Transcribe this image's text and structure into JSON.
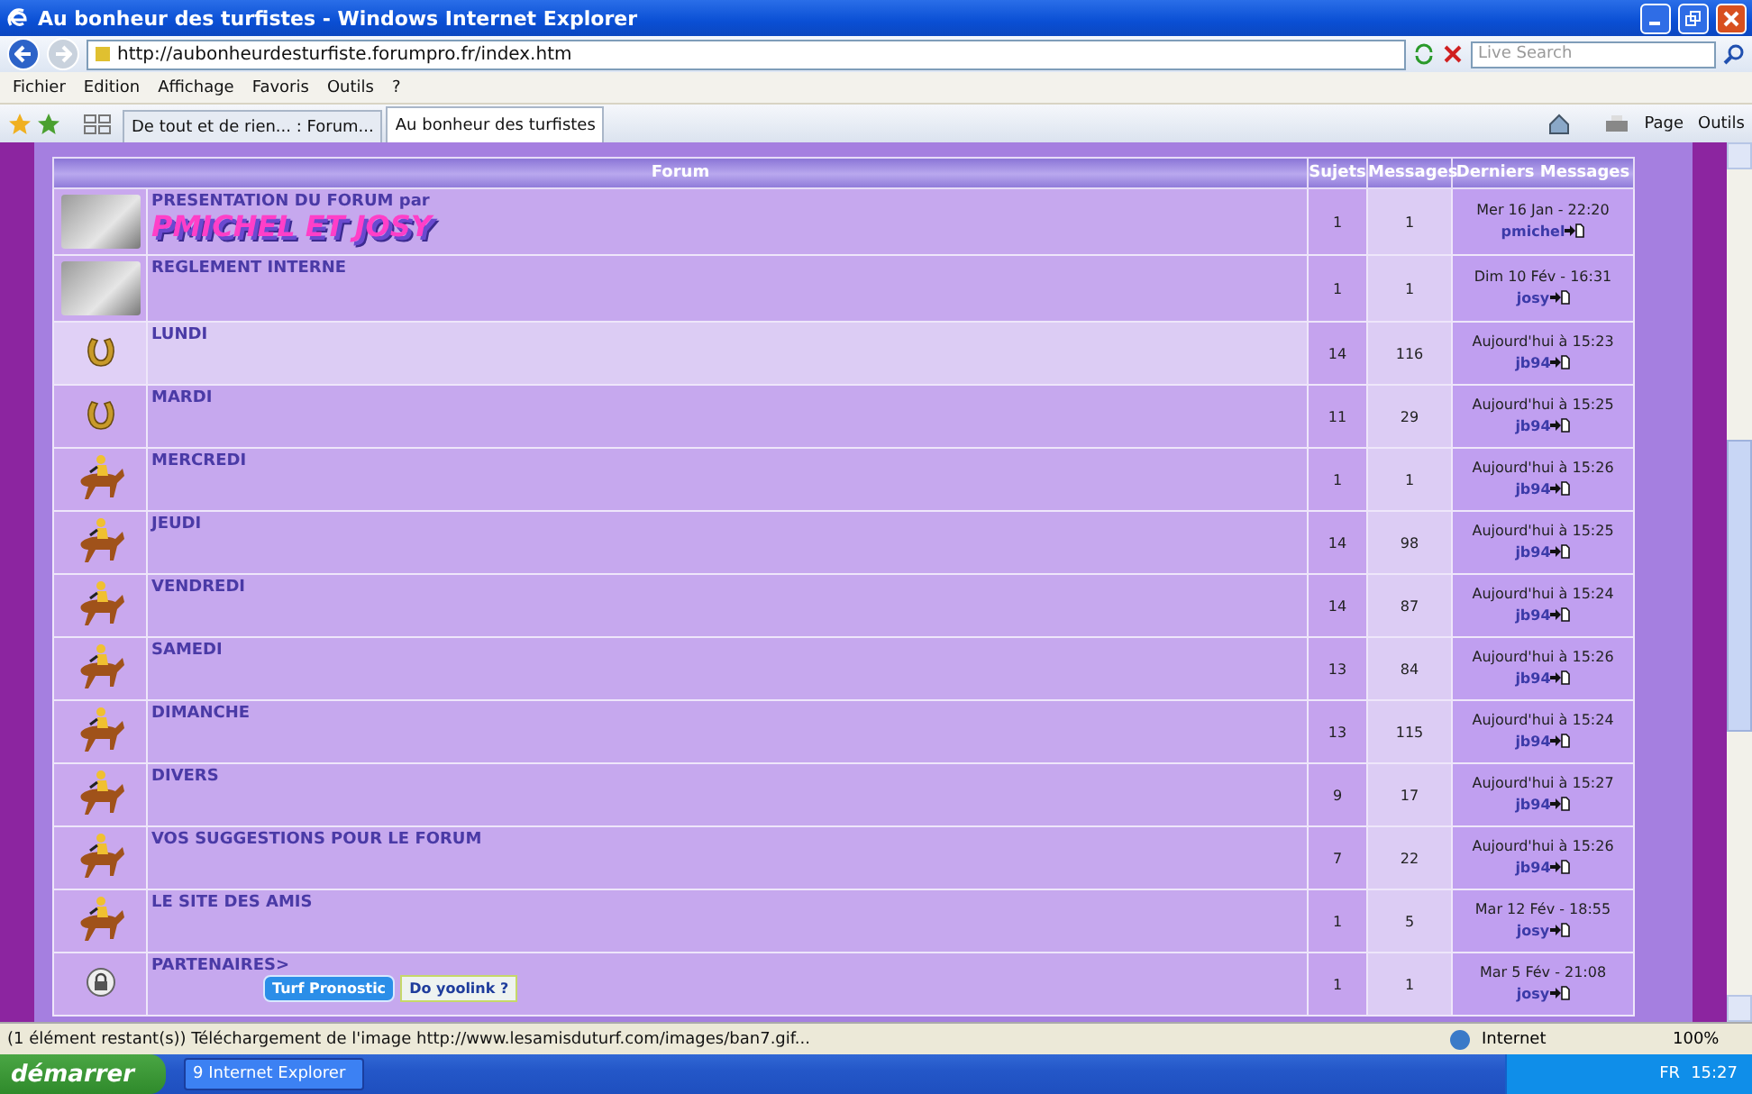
{
  "window": {
    "title": "Au bonheur des turfistes - Windows Internet Explorer"
  },
  "address": {
    "url": "http://aubonheurdesturfiste.forumpro.fr/index.htm"
  },
  "search": {
    "placeholder": "Live Search"
  },
  "menu": [
    "Fichier",
    "Edition",
    "Affichage",
    "Favoris",
    "Outils",
    "?"
  ],
  "tabs": [
    {
      "label": "De tout et de rien... : Forum...",
      "selected": false
    },
    {
      "label": "Au bonheur des turfistes",
      "selected": true
    }
  ],
  "toolbar": [
    "Page",
    "Outils"
  ],
  "table": {
    "columns": [
      "Forum",
      "Sujets",
      "Messages",
      "Derniers Messages"
    ],
    "rows": [
      {
        "kind": "photo",
        "title": "PRESENTATION DU FORUM par",
        "banner": "PMICHEL ET JOSY",
        "highlighted": false,
        "topics": "1",
        "posts": "1",
        "last_date": "Mer 16 Jan - 22:20",
        "last_user": "pmichel"
      },
      {
        "kind": "photo",
        "title": "REGLEMENT INTERNE",
        "highlighted": false,
        "topics": "1",
        "posts": "1",
        "last_date": "Dim 10 Fév - 16:31",
        "last_user": "josy"
      },
      {
        "kind": "horseshoe",
        "title": "LUNDI",
        "highlighted": true,
        "topics": "14",
        "posts": "116",
        "last_date": "Aujourd'hui à 15:23",
        "last_user": "jb94"
      },
      {
        "kind": "horseshoe",
        "title": "MARDI",
        "highlighted": false,
        "topics": "11",
        "posts": "29",
        "last_date": "Aujourd'hui à 15:25",
        "last_user": "jb94"
      },
      {
        "kind": "jockey",
        "title": "MERCREDI",
        "highlighted": false,
        "topics": "1",
        "posts": "1",
        "last_date": "Aujourd'hui à 15:26",
        "last_user": "jb94"
      },
      {
        "kind": "jockey",
        "title": "JEUDI",
        "highlighted": false,
        "topics": "14",
        "posts": "98",
        "last_date": "Aujourd'hui à 15:25",
        "last_user": "jb94"
      },
      {
        "kind": "jockey",
        "title": "VENDREDI",
        "highlighted": false,
        "topics": "14",
        "posts": "87",
        "last_date": "Aujourd'hui à 15:24",
        "last_user": "jb94"
      },
      {
        "kind": "jockey",
        "title": "SAMEDI",
        "highlighted": false,
        "topics": "13",
        "posts": "84",
        "last_date": "Aujourd'hui à 15:26",
        "last_user": "jb94"
      },
      {
        "kind": "jockey",
        "title": "DIMANCHE",
        "highlighted": false,
        "topics": "13",
        "posts": "115",
        "last_date": "Aujourd'hui à 15:24",
        "last_user": "jb94"
      },
      {
        "kind": "jockey",
        "title": "DIVERS",
        "highlighted": false,
        "topics": "9",
        "posts": "17",
        "last_date": "Aujourd'hui à 15:27",
        "last_user": "jb94"
      },
      {
        "kind": "jockey",
        "title": "VOS SUGGESTIONS POUR LE FORUM",
        "highlighted": false,
        "topics": "7",
        "posts": "22",
        "last_date": "Aujourd'hui à 15:26",
        "last_user": "jb94"
      },
      {
        "kind": "jockey",
        "title": "LE SITE DES AMIS",
        "highlighted": false,
        "topics": "1",
        "posts": "5",
        "last_date": "Mar 12 Fév - 18:55",
        "last_user": "josy"
      },
      {
        "kind": "lock",
        "title": "PARTENAIRES>",
        "links": [
          "Turf Pronostic",
          "Do yoolink ?"
        ],
        "highlighted": false,
        "topics": "1",
        "posts": "1",
        "last_date": "Mar 5 Fév - 21:08",
        "last_user": "josy"
      }
    ]
  },
  "status_bar": {
    "text": "(1 élément restant(s)) Téléchargement de l'image http://www.lesamisduturf.com/images/ban7.gif...",
    "zone": "Internet",
    "zoom": "100%"
  },
  "taskbar": {
    "start": "démarrer",
    "task": "9 Internet Explorer",
    "language": "FR",
    "clock": "15:27"
  }
}
